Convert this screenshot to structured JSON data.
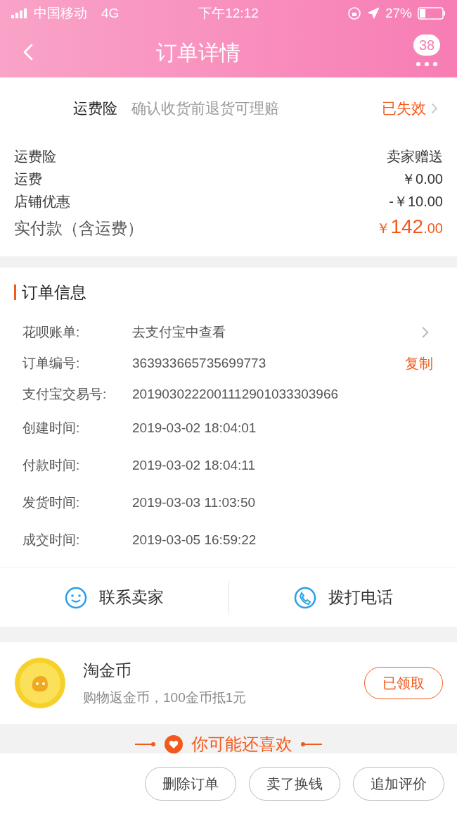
{
  "status_bar": {
    "carrier": "中国移动",
    "network": "4G",
    "time": "下午12:12",
    "battery": "27%"
  },
  "nav": {
    "title": "订单详情",
    "badge": "38"
  },
  "insurance": {
    "label": "运费险",
    "desc": "确认收货前退货可理赔",
    "status": "已失效"
  },
  "price_rows": [
    {
      "label": "运费险",
      "value": "卖家赠送"
    },
    {
      "label": "运费",
      "value": "￥0.00"
    },
    {
      "label": "店铺优惠",
      "value": "-￥10.00"
    }
  ],
  "total": {
    "label": "实付款（含运费）",
    "currency": "￥",
    "integer": "142",
    "decimal": ".00"
  },
  "order_info": {
    "title": "订单信息",
    "rows": [
      {
        "kind": "link",
        "label": "花呗账单:",
        "value": "去支付宝中查看"
      },
      {
        "kind": "copy",
        "label": "订单编号:",
        "value": "363933665735699773",
        "action": "复制"
      },
      {
        "kind": "text",
        "label": "支付宝交易号:",
        "value": "2019030222001112901033303966"
      },
      {
        "kind": "text",
        "label": "创建时间:",
        "value": "2019-03-02 18:04:01"
      },
      {
        "kind": "text",
        "label": "付款时间:",
        "value": "2019-03-02 18:04:11"
      },
      {
        "kind": "text",
        "label": "发货时间:",
        "value": "2019-03-03 11:03:50"
      },
      {
        "kind": "text",
        "label": "成交时间:",
        "value": "2019-03-05 16:59:22"
      }
    ]
  },
  "contact": [
    {
      "kind": "chat",
      "label": "联系卖家"
    },
    {
      "kind": "phone",
      "label": "拨打电话"
    }
  ],
  "coin": {
    "title": "淘金币",
    "desc": "购物返金币，100金币抵1元",
    "button": "已领取"
  },
  "recommend": {
    "title": "你可能还喜欢"
  },
  "actions": [
    "删除订单",
    "卖了换钱",
    "追加评价"
  ]
}
